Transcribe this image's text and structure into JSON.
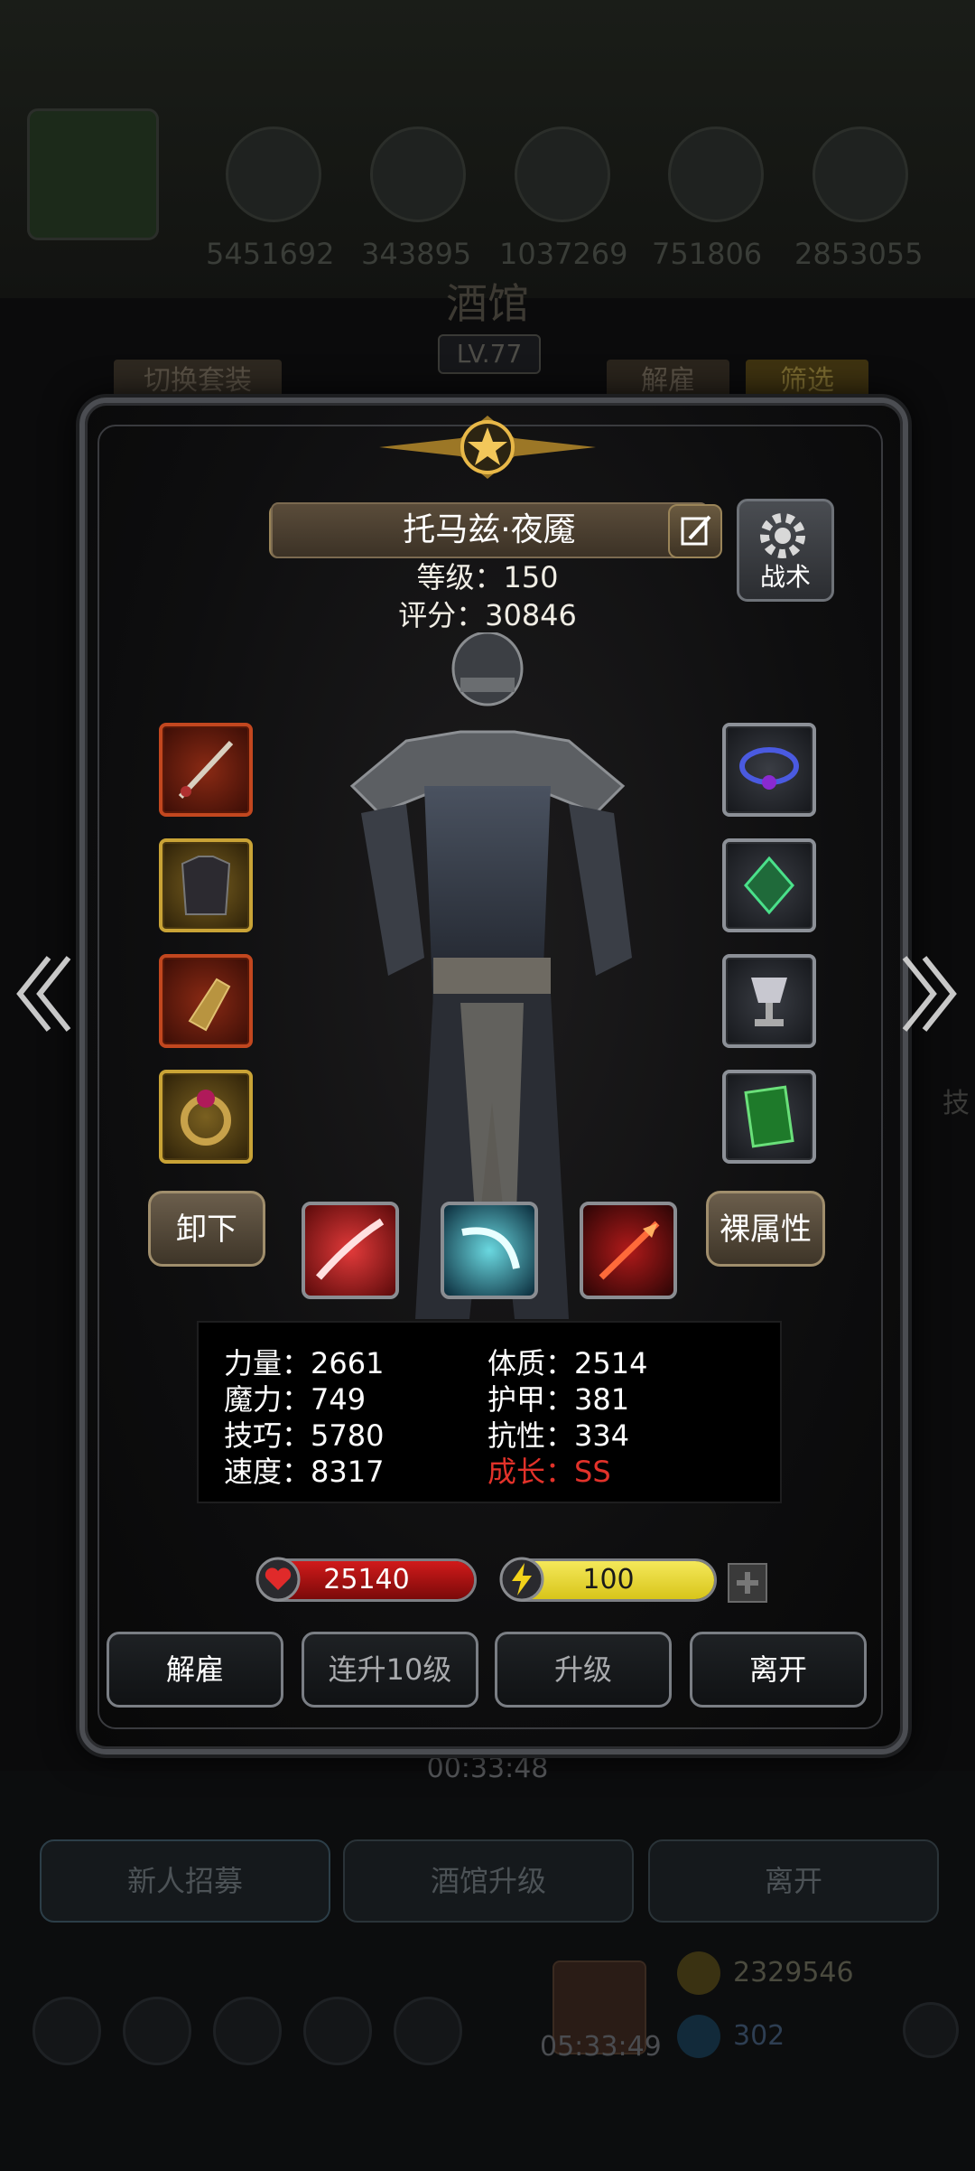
{
  "background": {
    "resources": [
      "5451692",
      "343895",
      "1037269",
      "751806",
      "2853055"
    ],
    "title": "酒馆",
    "level": "LV.77",
    "switch_outfit": "切换套装",
    "dismiss_tab": "解雇",
    "filter_tab": "筛选",
    "timer": "00:33:48",
    "bottom_buttons": [
      "新人招募",
      "酒馆升级",
      "离开"
    ],
    "gold": "2329546",
    "gems": "302",
    "chest_timer": "05:33:49",
    "side_text": "技"
  },
  "hero": {
    "name": "托马兹·夜魇",
    "level_text": "等级：150",
    "score_text": "评分：30846",
    "tactic_label": "战术"
  },
  "equipment": {
    "left": [
      "dagger-icon",
      "armor-icon",
      "gauntlet-icon",
      "ring-icon"
    ],
    "right": [
      "amulet-icon",
      "gem-icon",
      "chalice-icon",
      "tome-icon"
    ]
  },
  "buttons": {
    "unequip": "卸下",
    "base_attr": "裸属性"
  },
  "skills": [
    "slash-skill-icon",
    "whirl-skill-icon",
    "fire-spear-skill-icon"
  ],
  "stats": [
    {
      "label": "力量：2661"
    },
    {
      "label": "体质：2514"
    },
    {
      "label": "魔力：749"
    },
    {
      "label": "护甲：381"
    },
    {
      "label": "技巧：5780"
    },
    {
      "label": "抗性：334"
    },
    {
      "label": "速度：8317"
    },
    {
      "label": "成长：SS"
    }
  ],
  "hp": {
    "value": "25140",
    "fill": 1.0,
    "color": "#d11a1a"
  },
  "energy": {
    "value": "100",
    "fill": 1.0,
    "color": "#d8c51a"
  },
  "actions": {
    "dismiss": "解雇",
    "level10": "连升10级",
    "upgrade": "升级",
    "leave": "离开"
  },
  "colors": {
    "growth": "#e2322a",
    "panel_border": "#4b4d52"
  }
}
